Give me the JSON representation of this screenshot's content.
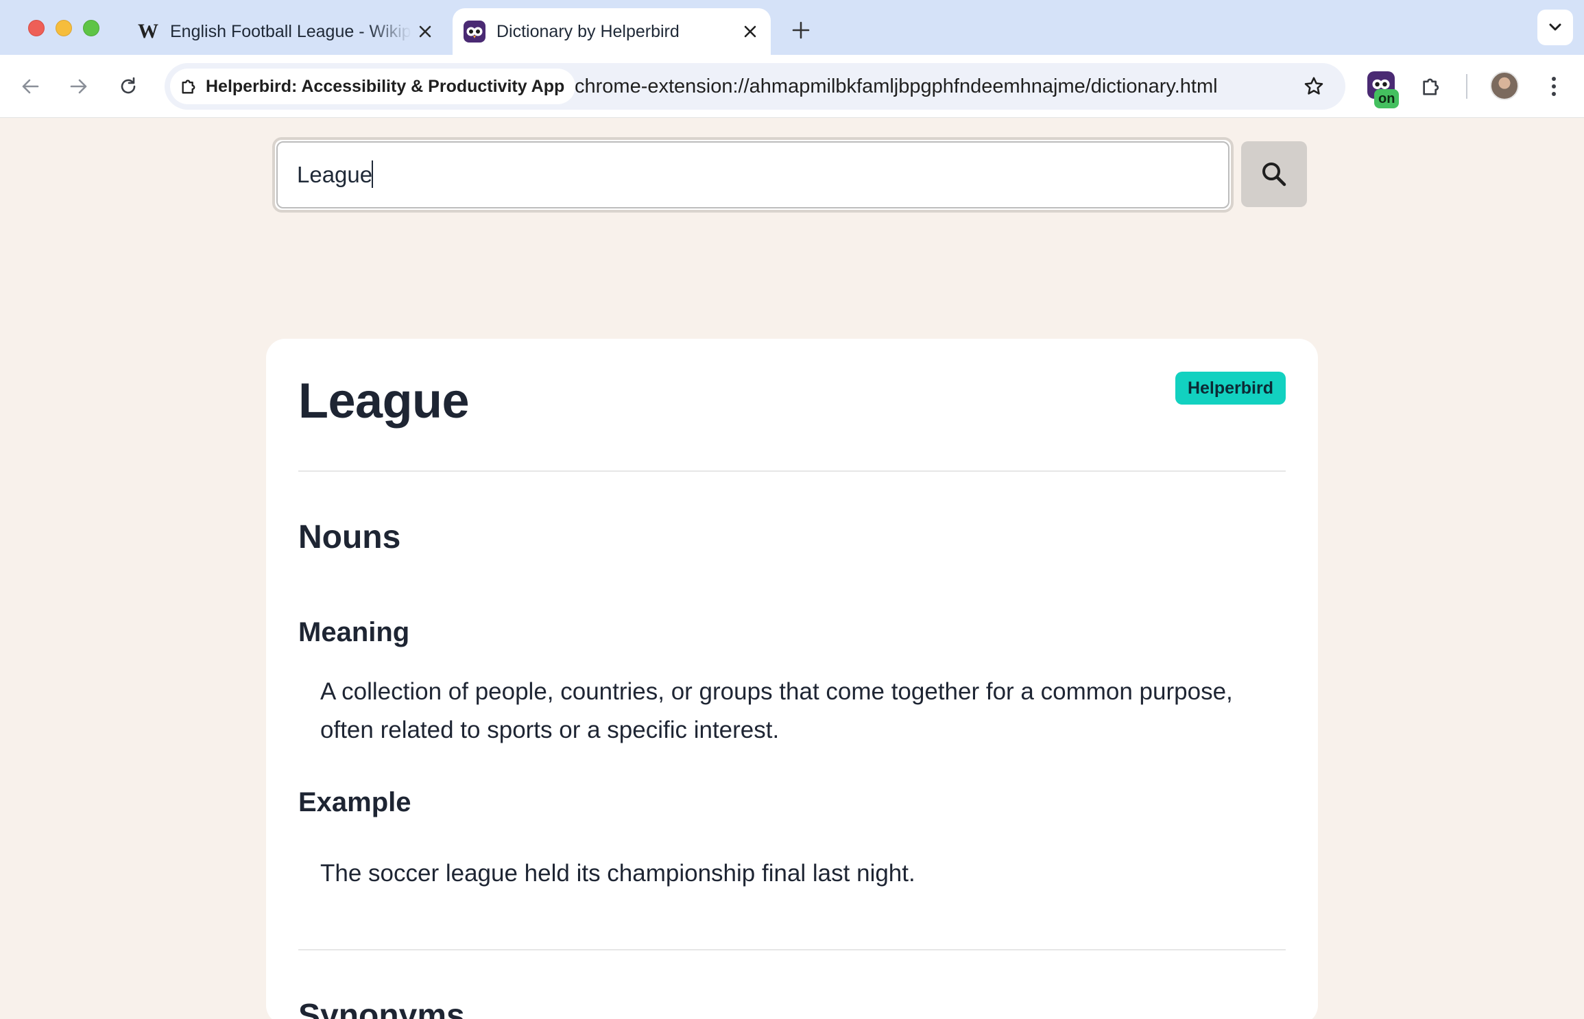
{
  "browser": {
    "tabs": [
      {
        "title": "English Football League - Wikipedia",
        "favicon": "wikipedia-w-icon",
        "active": false
      },
      {
        "title": "Dictionary by Helperbird",
        "favicon": "helperbird-owl-icon",
        "active": true
      }
    ],
    "site_chip": "Helperbird: Accessibility & Productivity App",
    "url": "chrome-extension://ahmapmilbkfamljbpgphfndeemhnajme/dictionary.html",
    "extension_badge": "on"
  },
  "search": {
    "value": "League",
    "button_icon": "search-icon"
  },
  "entry": {
    "word": "League",
    "source_badge": "Helperbird",
    "part_of_speech": "Nouns",
    "meaning_label": "Meaning",
    "meaning": "A collection of people, countries, or groups that come together for a common purpose, often related to sports or a specific interest.",
    "example_label": "Example",
    "example": "The soccer league held its championship final last night.",
    "synonyms_label": "Synonyms"
  },
  "colors": {
    "tabbar": "#d5e2f8",
    "page_background": "#f8f1eb",
    "badge": "#12d1c0",
    "text": "#1e2533"
  }
}
